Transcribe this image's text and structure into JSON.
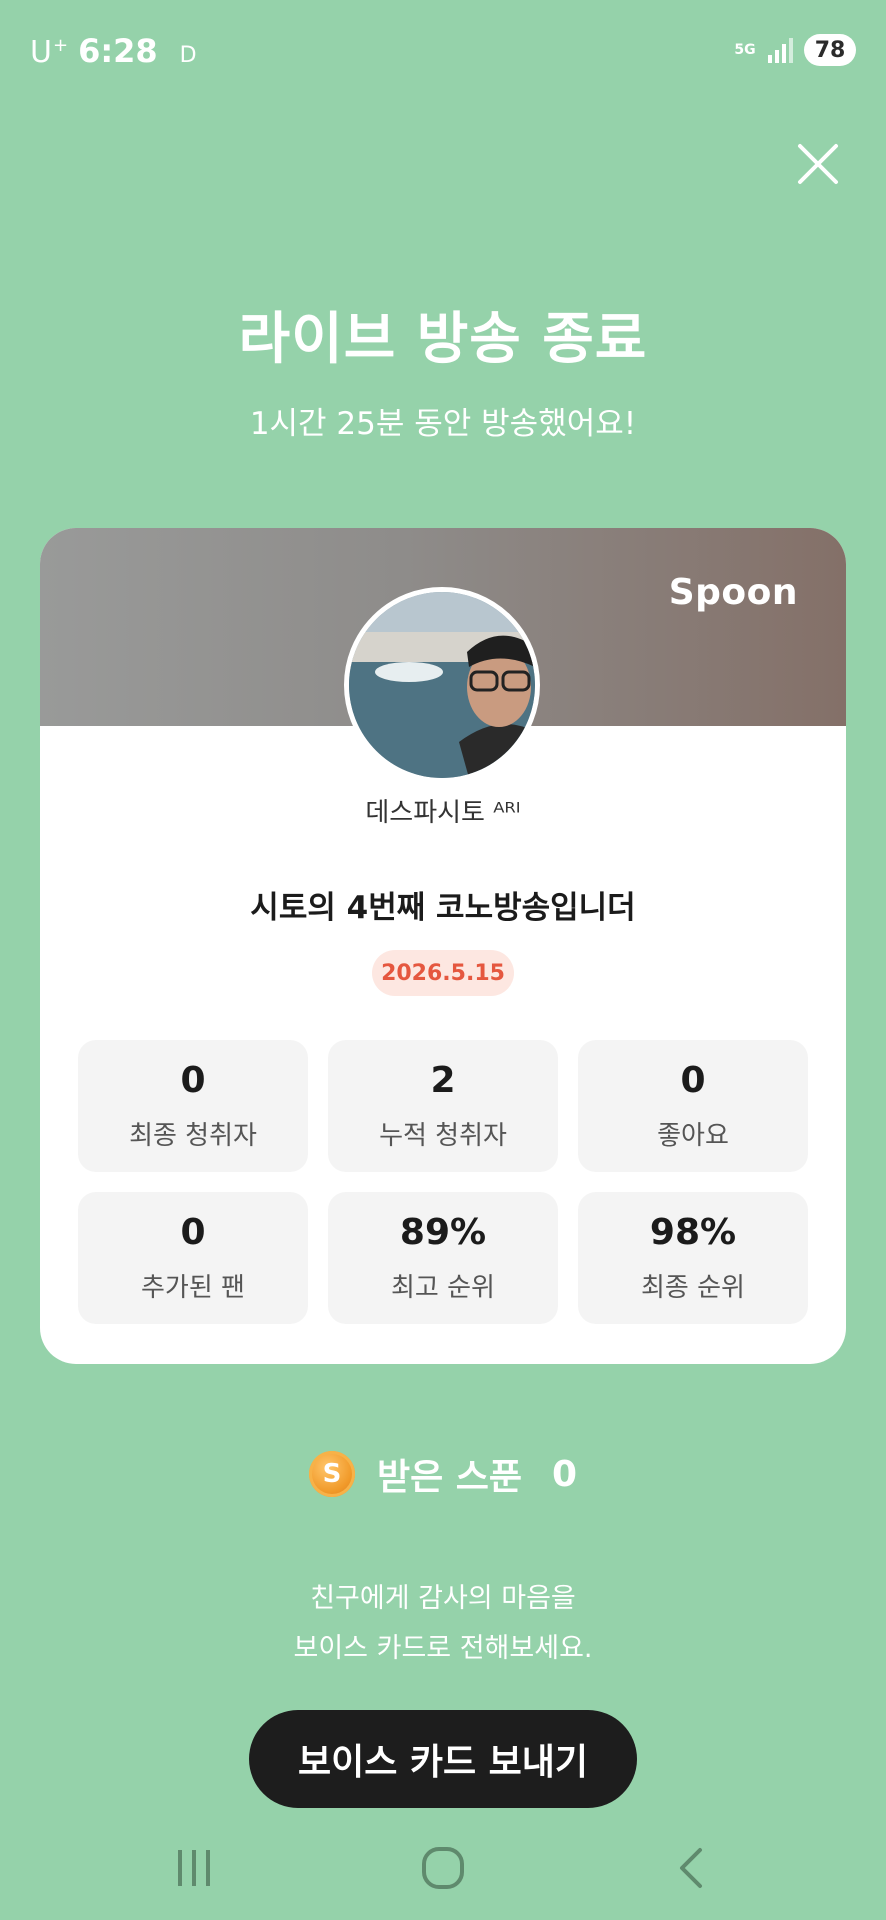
{
  "status_bar": {
    "carrier": "U",
    "carrier_sup": "+",
    "time": "6:28",
    "indicator": "D",
    "network": "5G",
    "battery": "78"
  },
  "header": {
    "title": "라이브 방송 종료",
    "subtitle": "1시간 25분 동안 방송했어요!"
  },
  "card": {
    "brand": "Spoon",
    "nickname": "데스파시토 ᴬᴿᴵ",
    "broadcast_title": "시토의 4번째 코노방송입니더",
    "date": "2026.5.15",
    "stats": [
      {
        "value": "0",
        "label": "최종 청취자"
      },
      {
        "value": "2",
        "label": "누적 청취자"
      },
      {
        "value": "0",
        "label": "좋아요"
      },
      {
        "value": "0",
        "label": "추가된 팬"
      },
      {
        "value": "89%",
        "label": "최고 순위"
      },
      {
        "value": "98%",
        "label": "최종 순위"
      }
    ]
  },
  "received": {
    "coin_letter": "S",
    "label": "받은 스푼",
    "count": "0"
  },
  "message": {
    "line1": "친구에게 감사의 마음을",
    "line2": "보이스 카드로 전해보세요."
  },
  "send_button": {
    "label": "보이스 카드 보내기"
  },
  "icons": {
    "close": "close-icon",
    "signal": "signal-icon",
    "recent_apps": "recent-apps-icon",
    "home": "home-icon",
    "back": "back-icon"
  },
  "colors": {
    "background": "#95D2AA",
    "date_badge_bg": "#fde7e1",
    "date_badge_text": "#e5573f",
    "button_bg": "#1d1d1d"
  }
}
